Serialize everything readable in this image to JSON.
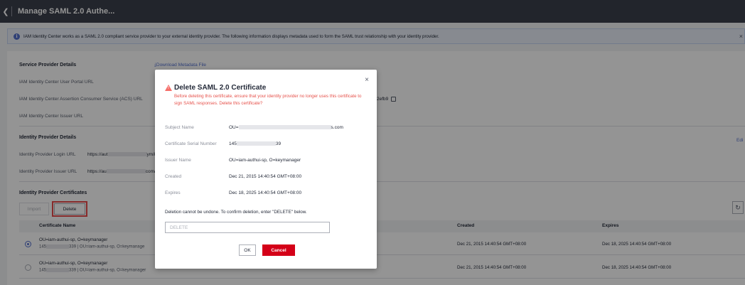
{
  "header": {
    "back_icon": "chevron-left-icon",
    "title": "Manage SAML 2.0 Authe..."
  },
  "banner": {
    "text": "IAM Identity Center works as a SAML 2.0 compliant service provider to your external identity provider. The following information displays metadata used to form the SAML trust relationship with your identity provider.",
    "close": "×"
  },
  "sp_details": {
    "title": "Service Provider Details",
    "download_link": "⤓Download Metadata File",
    "portal_url_label": "IAM Identity Center User Portal URL",
    "acs_url_label": "IAM Identity Center Assertion Consumer Service (ACS) URL",
    "acs_url_tail": "2efb9",
    "issuer_url_label": "IAM Identity Center Issuer URL"
  },
  "idp_details": {
    "title": "Identity Provider Details",
    "edit": "Edi",
    "login_url_label": "Identity Provider Login URL",
    "login_url_a": "https://aut",
    "login_url_b": "ym/i",
    "issuer_url_label": "Identity Provider Issuer URL",
    "issuer_url_a": "https://au",
    "issuer_url_b": "com/"
  },
  "certificates": {
    "title": "Identity Provider Certificates",
    "import_label": "Import",
    "delete_label": "Delete",
    "refresh_icon": "refresh-icon",
    "columns": {
      "name": "Certificate Name",
      "created": "Created",
      "expires": "Expires"
    },
    "rows": [
      {
        "selected": true,
        "name": "OU=iam-authui-sp, O=keymanager",
        "serial_a": "145",
        "serial_b": "339 | OU=iam-authui-sp, O=keymanage",
        "created": "Dec 21, 2015 14:40:54 GMT+08:00",
        "expires": "Dec 18, 2025 14:40:54 GMT+08:00"
      },
      {
        "selected": false,
        "name": "OU=iam-authui-sp, O=keymanager",
        "serial_a": "145",
        "serial_b": "339 | OU=iam-authui-sp, O=keymanager",
        "created": "Dec 21, 2015 14:40:54 GMT+08:00",
        "expires": "Dec 18, 2025 14:40:54 GMT+08:00"
      }
    ]
  },
  "dialog": {
    "title": "Delete SAML 2.0 Certificate",
    "warning": "Before deleting this certificate, ensure that your identity provider no longer uses this certificate to sign SAML responses. Delete this certificate?",
    "close": "×",
    "subject_label": "Subject Name",
    "subject_a": "OU=",
    "subject_b": "s.com",
    "serial_label": "Certificate Serial Number",
    "serial_a": "145",
    "serial_b": "39",
    "issuer_label": "Issuer Name",
    "issuer_value": "OU=iam-authui-sp, O=keymanager",
    "created_label": "Created",
    "created_value": "Dec 21, 2015 14:40:54 GMT+08:00",
    "expires_label": "Expires",
    "expires_value": "Dec 18, 2025 14:40:54 GMT+08:00",
    "confirm_note": "Deletion cannot be undone. To confirm deletion, enter \"DELETE\" below.",
    "input_placeholder": "DELETE",
    "ok_label": "OK",
    "cancel_label": "Cancel"
  },
  "colors": {
    "topbar": "#3c404c",
    "accent": "#526ecc",
    "danger": "#d40018",
    "warning_text": "#e6504a",
    "highlight_box": "#e84b4b"
  }
}
